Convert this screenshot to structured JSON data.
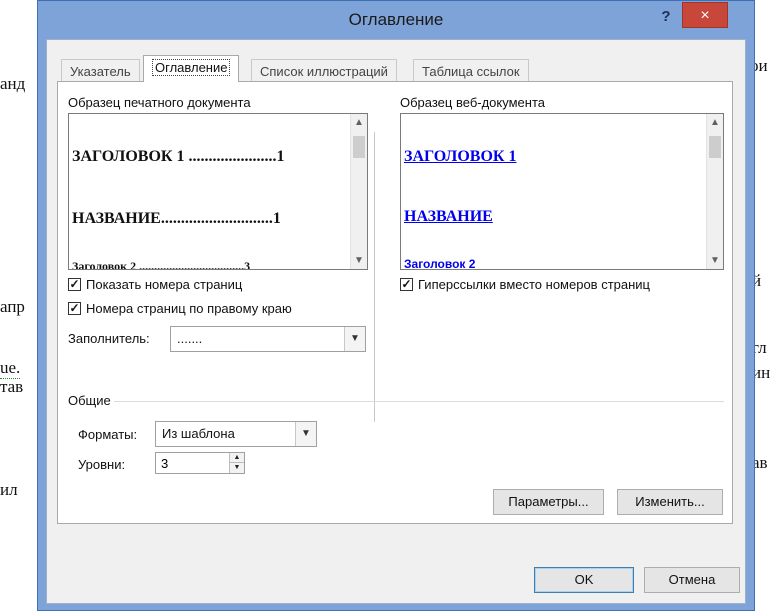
{
  "background_fragments": [
    "ои",
    "анд",
    "й",
    "апр",
    "гл",
    "ue.",
    "ин",
    "тав",
    "ав",
    "ил"
  ],
  "dialog": {
    "title": "Оглавление",
    "help_label": "?",
    "close_label": "×",
    "tabs": [
      {
        "label": "Указатель",
        "active": false
      },
      {
        "label": "Оглавление",
        "active": true
      },
      {
        "label": "Список иллюстраций",
        "active": false
      },
      {
        "label": "Таблица ссылок",
        "active": false
      }
    ],
    "print_preview": {
      "label": "Образец печатного документа",
      "lines": [
        "ЗАГОЛОВОК 1 ......................1",
        "НАЗВАНИЕ............................1",
        "Заголовок 2 ...................................3"
      ]
    },
    "web_preview": {
      "label": "Образец веб-документа",
      "lines": [
        "ЗАГОЛОВОК 1",
        "НАЗВАНИЕ",
        "Заголовок 2"
      ]
    },
    "show_page_numbers": {
      "label": "Показать номера страниц",
      "checked": true
    },
    "right_align": {
      "label": "Номера страниц по правому краю",
      "checked": true
    },
    "hyperlinks": {
      "label": "Гиперссылки вместо номеров страниц",
      "checked": true
    },
    "tab_leader": {
      "label": "Заполнитель:",
      "value": "......."
    },
    "general": {
      "label": "Общие",
      "formats": {
        "label": "Форматы:",
        "value": "Из шаблона"
      },
      "levels": {
        "label": "Уровни:",
        "value": "3"
      }
    },
    "buttons": {
      "options": "Параметры...",
      "modify": "Изменить...",
      "ok": "OK",
      "cancel": "Отмена"
    },
    "colors": {
      "link": "#0000ee",
      "close": "#c7473a",
      "frame": "#7ea3d8"
    },
    "icons": {
      "checkbox": "check-mark",
      "dropdown": "chevron-down-icon",
      "scroll_up": "chevron-up-icon",
      "scroll_down": "chevron-down-icon"
    }
  }
}
